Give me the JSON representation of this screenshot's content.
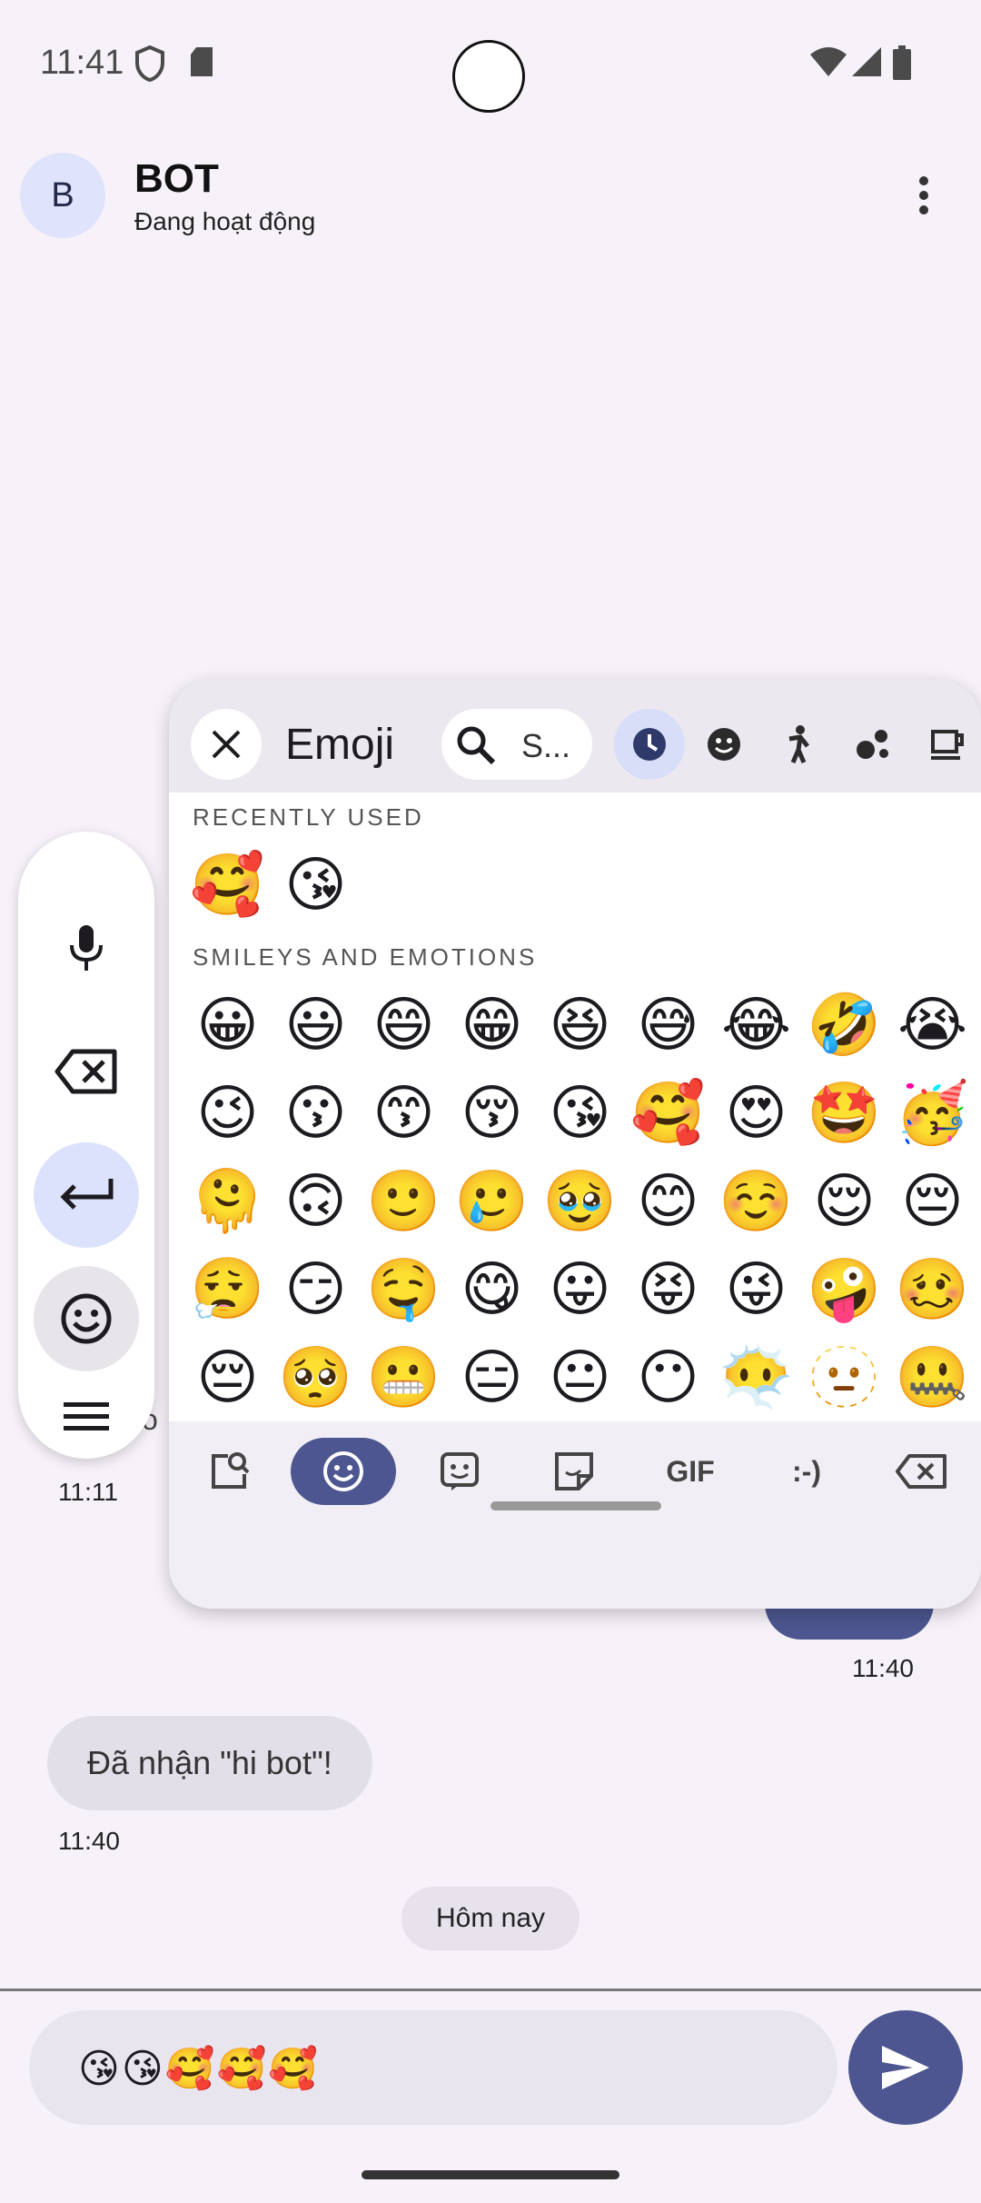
{
  "status": {
    "time": "11:41"
  },
  "header": {
    "avatar_letter": "B",
    "title": "BOT",
    "subtitle": "Đang hoạt động"
  },
  "chat": {
    "partial_text": "o",
    "time_1": "11:11",
    "time_2": "11:40",
    "received_message": "Đã nhận \"hi bot\"!",
    "time_3": "11:40",
    "date_chip": "Hôm nay"
  },
  "input": {
    "value": "😘😘🥰🥰🥰"
  },
  "emoji_panel": {
    "title": "Emoji",
    "search_placeholder": "S...",
    "section_recent": "RECENTLY USED",
    "recent": [
      "🥰",
      "😘"
    ],
    "section_smileys": "SMILEYS AND EMOTIONS",
    "rows": [
      [
        "😀",
        "😃",
        "😄",
        "😁",
        "😆",
        "😅",
        "😂",
        "🤣",
        "😭"
      ],
      [
        "😉",
        "😗",
        "😙",
        "😚",
        "😘",
        "🥰",
        "😍",
        "🤩",
        "🥳"
      ],
      [
        "🫠",
        "🙃",
        "🙂",
        "🥲",
        "🥹",
        "😊",
        "☺️",
        "😌",
        "😔"
      ],
      [
        "😮‍💨",
        "😏",
        "🤤",
        "😋",
        "😛",
        "😝",
        "😜",
        "🤪",
        "🥴"
      ],
      [
        "😔",
        "🥺",
        "😬",
        "😑",
        "😐",
        "😶",
        "😶‍🌫️",
        "🫥",
        "🤐"
      ]
    ],
    "bottom_gif": "GIF",
    "bottom_emoticon": ":-)"
  }
}
